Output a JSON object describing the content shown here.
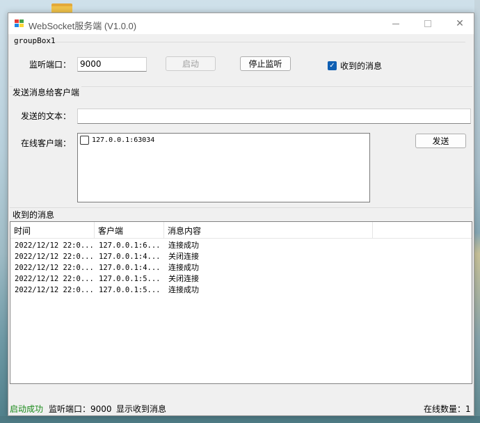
{
  "window": {
    "title": "WebSocket服务端 (V1.0.0)"
  },
  "groupbox1": {
    "title": "groupBox1",
    "port_label": "监听端口：",
    "port_value": "9000",
    "start_button": "启动",
    "stop_button": "停止监听",
    "received_checkbox": "收到的消息"
  },
  "send_section": {
    "title": "发送消息给客户端",
    "text_label": "发送的文本：",
    "text_value": "",
    "online_label": "在线客户端：",
    "clients": [
      "127.0.0.1:63034"
    ],
    "send_button": "发送"
  },
  "messages": {
    "title": "收到的消息",
    "columns": [
      "时间",
      "客户端",
      "消息内容"
    ],
    "rows": [
      [
        "2022/12/12 22:0...",
        "127.0.0.1:6...",
        "连接成功"
      ],
      [
        "2022/12/12 22:0...",
        "127.0.0.1:4...",
        "关闭连接"
      ],
      [
        "2022/12/12 22:0...",
        "127.0.0.1:4...",
        "连接成功"
      ],
      [
        "2022/12/12 22:0...",
        "127.0.0.1:5...",
        "关闭连接"
      ],
      [
        "2022/12/12 22:0...",
        "127.0.0.1:5...",
        "连接成功"
      ]
    ]
  },
  "status": {
    "state": "启动成功",
    "port": "监听端口：9000",
    "mode": "显示收到消息",
    "online": "在线数量：1",
    "state_color": "#1a8a1a"
  }
}
